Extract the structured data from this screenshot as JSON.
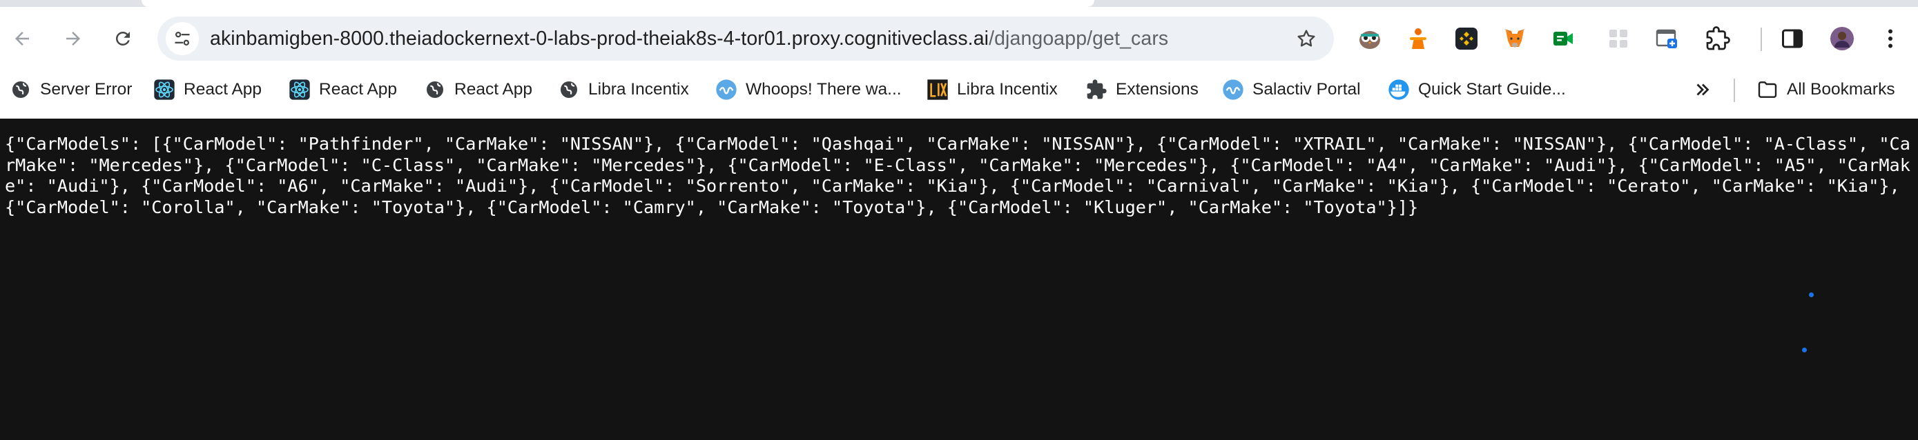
{
  "browser": {
    "url_host": "akinbamigben-8000.theiadockernext-0-labs-prod-theiak8s-4-tor01.proxy.cognitiveclass.ai",
    "url_path": "/djangoapp/get_cars",
    "icons": {
      "back": "arrow-left-icon",
      "forward": "arrow-right-icon",
      "reload": "reload-icon",
      "site_info": "tune-icon",
      "bookmark": "star-icon",
      "side_panel": "side-panel-icon",
      "extensions": "puzzle-icon"
    },
    "accent_color": "#1a73e8"
  },
  "bookmarks": {
    "items": [
      {
        "label": "Server Error",
        "icon": "globe-icon"
      },
      {
        "label": "React App",
        "icon": "react-icon"
      },
      {
        "label": "React App",
        "icon": "react-icon"
      },
      {
        "label": "React App",
        "icon": "globe-icon"
      },
      {
        "label": "Libra Incentix",
        "icon": "globe-icon"
      },
      {
        "label": "Whoops! There wa...",
        "icon": "wave-icon"
      },
      {
        "label": "Libra Incentix",
        "icon": "lix-icon"
      },
      {
        "label": "Extensions",
        "icon": "puzzle-icon"
      },
      {
        "label": "Salactiv Portal",
        "icon": "wave-icon"
      },
      {
        "label": "Quick Start Guide...",
        "icon": "docker-icon"
      }
    ],
    "all_bookmarks_label": "All Bookmarks"
  },
  "page": {
    "json_text": "{\"CarModels\": [{\"CarModel\": \"Pathfinder\", \"CarMake\": \"NISSAN\"}, {\"CarModel\": \"Qashqai\", \"CarMake\": \"NISSAN\"}, {\"CarModel\": \"XTRAIL\", \"CarMake\": \"NISSAN\"}, {\"CarModel\": \"A-Class\", \"CarMake\": \"Mercedes\"}, {\"CarModel\": \"C-Class\", \"CarMake\": \"Mercedes\"}, {\"CarModel\": \"E-Class\", \"CarMake\": \"Mercedes\"}, {\"CarModel\": \"A4\", \"CarMake\": \"Audi\"}, {\"CarModel\": \"A5\", \"CarMake\": \"Audi\"}, {\"CarModel\": \"A6\", \"CarMake\": \"Audi\"}, {\"CarModel\": \"Sorrento\", \"CarMake\": \"Kia\"}, {\"CarModel\": \"Carnival\", \"CarMake\": \"Kia\"}, {\"CarModel\": \"Cerato\", \"CarMake\": \"Kia\"}, {\"CarModel\": \"Corolla\", \"CarMake\": \"Toyota\"}, {\"CarModel\": \"Camry\", \"CarMake\": \"Toyota\"}, {\"CarModel\": \"Kluger\", \"CarMake\": \"Toyota\"}]}",
    "background": "#131313"
  }
}
